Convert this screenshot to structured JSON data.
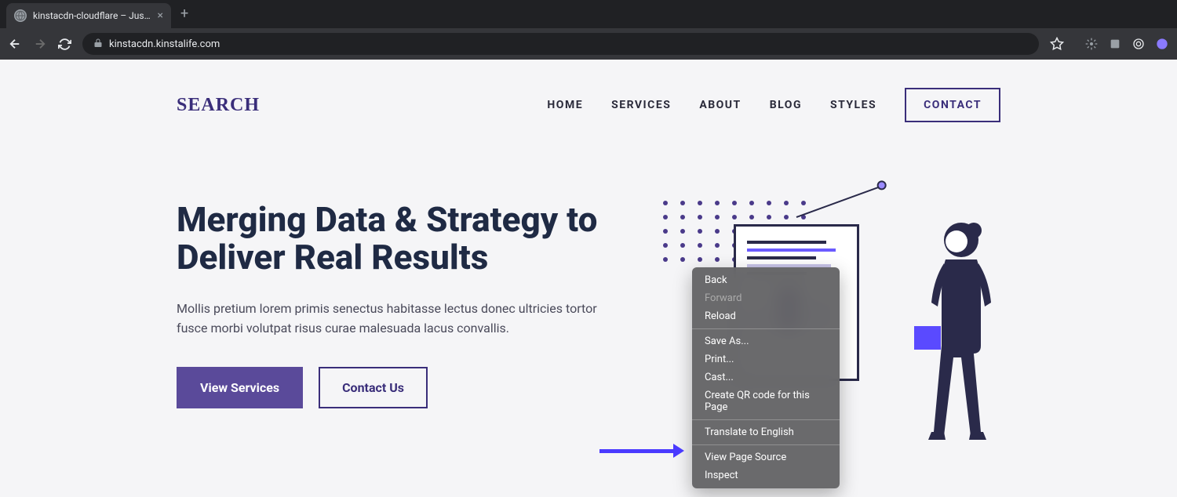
{
  "browser": {
    "tab_title": "kinstacdn-cloudflare – Just an",
    "url": "kinstacdn.kinstalife.com"
  },
  "site": {
    "logo": "SEARCH",
    "nav": [
      "HOME",
      "SERVICES",
      "ABOUT",
      "BLOG",
      "STYLES"
    ],
    "nav_contact": "CONTACT",
    "hero_title": "Merging Data & Strategy to Deliver Real Results",
    "hero_sub": "Mollis pretium lorem primis senectus habitasse lectus donec ultricies tortor fusce morbi volutpat risus curae malesuada lacus convallis.",
    "btn_primary": "View Services",
    "btn_secondary": "Contact Us"
  },
  "colors": {
    "chart_line_dark": "#2a2a4a",
    "chart_line_accent": "#6a5aff",
    "chart_line_muted": "#c8c4e8",
    "bar_light": "#d8d4f0",
    "bar_dark": "#5a4a9a"
  },
  "context_menu": {
    "items": [
      {
        "label": "Back",
        "enabled": true
      },
      {
        "label": "Forward",
        "enabled": false
      },
      {
        "label": "Reload",
        "enabled": true
      },
      {
        "sep": true
      },
      {
        "label": "Save As...",
        "enabled": true
      },
      {
        "label": "Print...",
        "enabled": true
      },
      {
        "label": "Cast...",
        "enabled": true
      },
      {
        "label": "Create QR code for this Page",
        "enabled": true
      },
      {
        "sep": true
      },
      {
        "label": "Translate to English",
        "enabled": true
      },
      {
        "sep": true
      },
      {
        "label": "View Page Source",
        "enabled": true
      },
      {
        "label": "Inspect",
        "enabled": true
      }
    ]
  }
}
